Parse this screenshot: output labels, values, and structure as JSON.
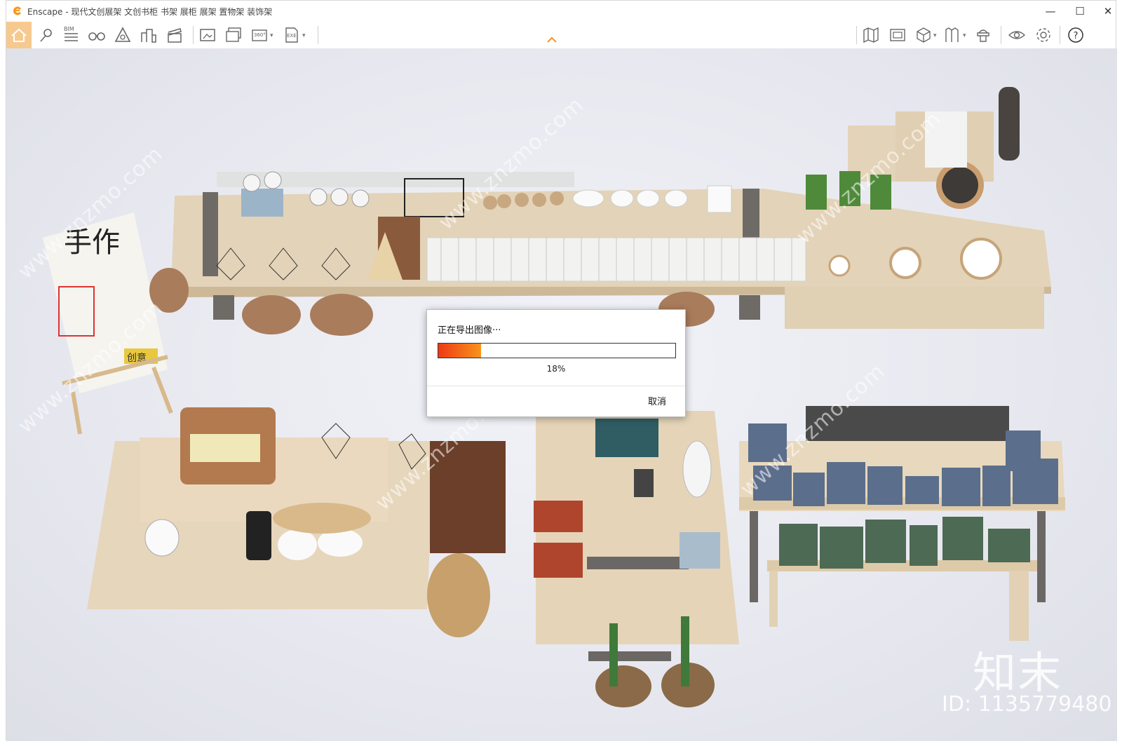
{
  "app": {
    "title": "Enscape - 现代文创展架 文创书柜 书架 展柜 展架 置物架 装饰架"
  },
  "toolbar": {
    "left_icons": [
      "home-icon",
      "location-icon",
      "bim-icon",
      "binoculars-icon",
      "atmosphere-icon",
      "buildings-icon",
      "clapper-icon",
      "screenshot-icon",
      "batch-render-icon",
      "panorama-360-icon",
      "export-exe-icon"
    ],
    "right_icons": [
      "map-icon",
      "minimap-icon",
      "cube-icon",
      "asset-library-icon",
      "material-editor-icon",
      "visual-settings-icon",
      "settings-icon",
      "help-icon"
    ],
    "bim_label": "BIM",
    "pano_label": "360°",
    "exe_label": "EXE"
  },
  "dialog": {
    "title": "正在导出图像···",
    "progress": 18,
    "progress_text": "18%",
    "cancel_label": "取消"
  },
  "watermark": {
    "brand": "知末",
    "id_text": "ID: 1135779480",
    "diagonal_text": "www.znzmo.com"
  },
  "scene": {
    "poster_text": "手作",
    "poster_sub": "创意"
  },
  "colors": {
    "accent": "#f7941d",
    "progress_start": "#ee3a15",
    "home_bg": "#f6c98f"
  }
}
